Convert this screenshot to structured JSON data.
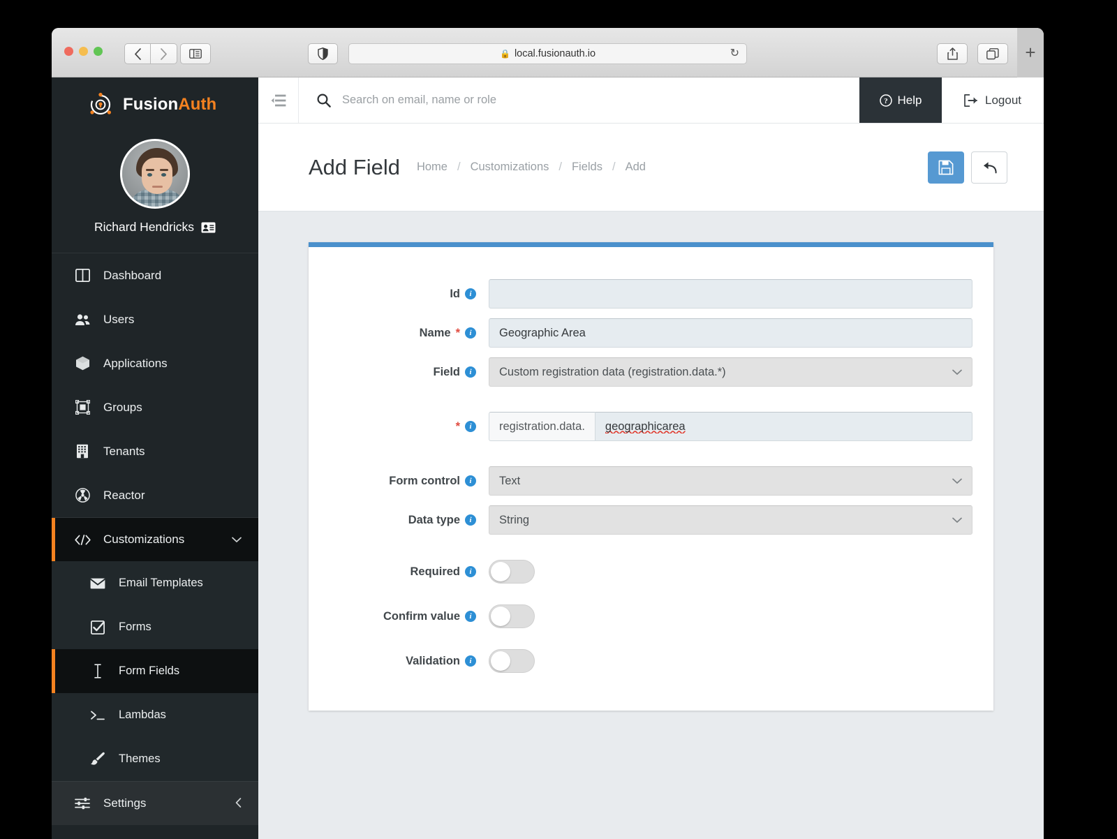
{
  "browser": {
    "url": "local.fusionauth.io",
    "lock_icon": "lock-icon",
    "back_icon": "chevron-left-icon",
    "forward_icon": "chevron-right-icon",
    "sidebar_icon": "sidebar-panel-icon",
    "shield_icon": "shield-icon",
    "reload_icon": "reload-icon",
    "share_icon": "share-icon",
    "tabs_icon": "tab-overview-icon",
    "new_tab_label": "+"
  },
  "sidebar": {
    "brand": {
      "first": "Fusion",
      "second": "Auth",
      "logo_icon": "fusionauth-logo-icon"
    },
    "profile": {
      "name": "Richard Hendricks",
      "badge_icon": "id-card-icon",
      "avatar_icon": "user-avatar"
    },
    "items": [
      {
        "label": "Dashboard",
        "icon": "dashboard-icon",
        "active": false
      },
      {
        "label": "Users",
        "icon": "users-icon",
        "active": false
      },
      {
        "label": "Applications",
        "icon": "applications-icon",
        "active": false
      },
      {
        "label": "Groups",
        "icon": "groups-icon",
        "active": false
      },
      {
        "label": "Tenants",
        "icon": "tenants-icon",
        "active": false
      },
      {
        "label": "Reactor",
        "icon": "reactor-icon",
        "active": false
      }
    ],
    "customizations": {
      "label": "Customizations",
      "icon": "code-icon",
      "chevron": "chevron-down-icon",
      "active": true
    },
    "sub_items": [
      {
        "label": "Email Templates",
        "icon": "envelope-icon",
        "active": false
      },
      {
        "label": "Forms",
        "icon": "checkbox-icon",
        "active": false
      },
      {
        "label": "Form Fields",
        "icon": "text-cursor-icon",
        "active": true
      },
      {
        "label": "Lambdas",
        "icon": "terminal-icon",
        "active": false
      },
      {
        "label": "Themes",
        "icon": "paintbrush-icon",
        "active": false
      }
    ],
    "settings": {
      "label": "Settings",
      "icon": "sliders-icon",
      "chevron": "chevron-left-icon"
    }
  },
  "header": {
    "collapse_icon": "collapse-sidebar-icon",
    "search": {
      "placeholder": "Search on email, name or role",
      "value": "",
      "icon": "search-icon"
    },
    "help": {
      "label": "Help",
      "icon": "help-circle-icon"
    },
    "logout": {
      "label": "Logout",
      "icon": "logout-icon"
    }
  },
  "page": {
    "title": "Add Field",
    "breadcrumb": [
      "Home",
      "Customizations",
      "Fields",
      "Add"
    ],
    "breadcrumb_separator": "/",
    "actions": {
      "save": {
        "name": "save-button",
        "icon": "floppy-disk-icon"
      },
      "back": {
        "name": "back-button",
        "icon": "arrow-return-icon"
      }
    }
  },
  "form": {
    "accent_color": "#4a90cc",
    "fields": {
      "id": {
        "label": "Id",
        "value": "",
        "required": false
      },
      "name": {
        "label": "Name",
        "value": "Geographic Area",
        "required": true
      },
      "field": {
        "label": "Field",
        "value": "Custom registration data (registration.data.*)"
      },
      "key": {
        "label": "",
        "prefix": "registration.data.",
        "value": "geographicarea",
        "required": true
      },
      "form_control": {
        "label": "Form control",
        "value": "Text"
      },
      "data_type": {
        "label": "Data type",
        "value": "String"
      },
      "required": {
        "label": "Required",
        "on": false
      },
      "confirm_value": {
        "label": "Confirm value",
        "on": false
      },
      "validation": {
        "label": "Validation",
        "on": false
      }
    }
  }
}
